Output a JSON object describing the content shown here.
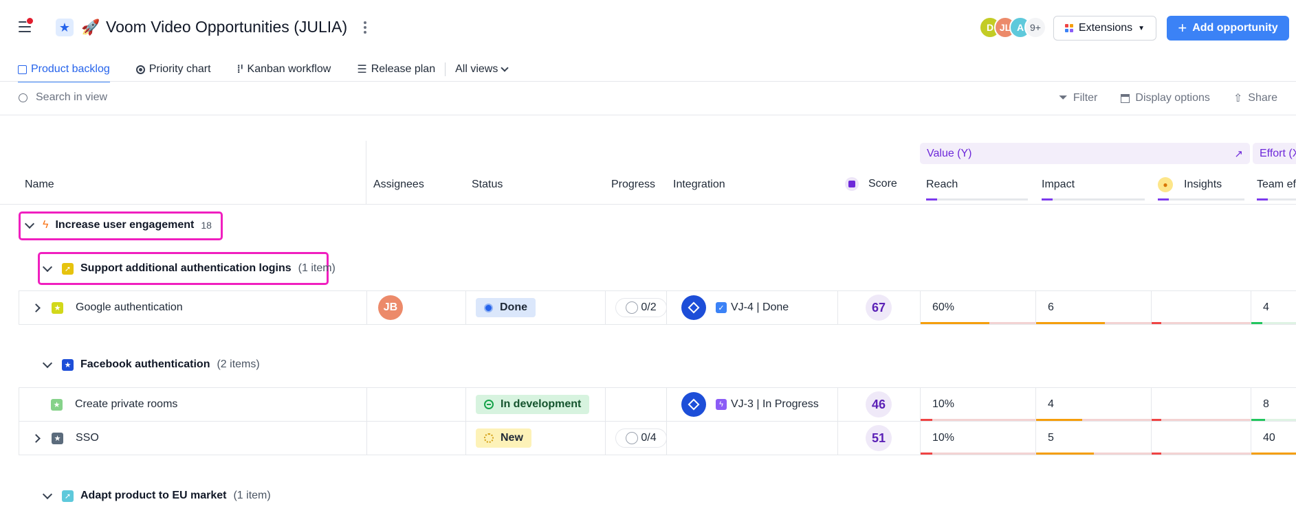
{
  "header": {
    "title": "Voom Video Opportunities (JULIA)",
    "avatars": [
      {
        "initials": "D",
        "color": "#c3cc25"
      },
      {
        "initials": "JL",
        "color": "#ec8a6a"
      },
      {
        "initials": "A",
        "color": "#5ec9db"
      },
      {
        "initials": "9+",
        "color": "#f3f4f6"
      }
    ],
    "extensions_label": "Extensions",
    "add_label": "Add opportunity"
  },
  "tabs": [
    {
      "label": "Product backlog",
      "icon": "list-icon",
      "active": true
    },
    {
      "label": "Priority chart",
      "icon": "target-icon"
    },
    {
      "label": "Kanban workflow",
      "icon": "kanban-icon"
    },
    {
      "label": "Release plan",
      "icon": "roadmap-icon"
    },
    {
      "label": "All views",
      "icon": "chevron-down-icon"
    }
  ],
  "toolbar": {
    "search_placeholder": "Search in view",
    "filter": "Filter",
    "display_options": "Display options",
    "share": "Share"
  },
  "columns": {
    "name": "Name",
    "assignees": "Assignees",
    "status": "Status",
    "progress": "Progress",
    "integration": "Integration",
    "score": "Score",
    "value_group": "Value (Y)",
    "reach": "Reach",
    "impact": "Impact",
    "insights": "Insights",
    "effort_group": "Effort (X",
    "team_effort": "Team ef"
  },
  "groups": {
    "g1": {
      "label": "Increase user engagement",
      "count": "18"
    },
    "g2": {
      "label": "Support additional authentication logins",
      "count": "(1 item)"
    },
    "g3": {
      "label": "Facebook authentication",
      "count": "(2 items)"
    },
    "g4": {
      "label": "Adapt product to EU market",
      "count": "(1 item)"
    }
  },
  "rows": [
    {
      "name": "Google authentication",
      "assignee": "JB",
      "status": "Done",
      "progress": "0/2",
      "integration": "VJ-4 | Done",
      "score": "67",
      "reach": "60%",
      "impact": "6",
      "team_effort": "4"
    },
    {
      "name": "Create private rooms",
      "assignee": "",
      "status": "In development",
      "progress": "",
      "integration": "VJ-3 | In Progress",
      "score": "46",
      "reach": "10%",
      "impact": "4",
      "team_effort": "8"
    },
    {
      "name": "SSO",
      "assignee": "",
      "status": "New",
      "progress": "0/4",
      "integration": "",
      "score": "51",
      "reach": "10%",
      "impact": "5",
      "team_effort": "40"
    }
  ],
  "colors": {
    "accent": "#3b82f6",
    "highlight": "#f01fbf",
    "done_bg": "#dbe7fb",
    "dev_bg": "#d7f3df",
    "new_bg": "#fdf2b8",
    "score_fg": "#5b21b6"
  }
}
